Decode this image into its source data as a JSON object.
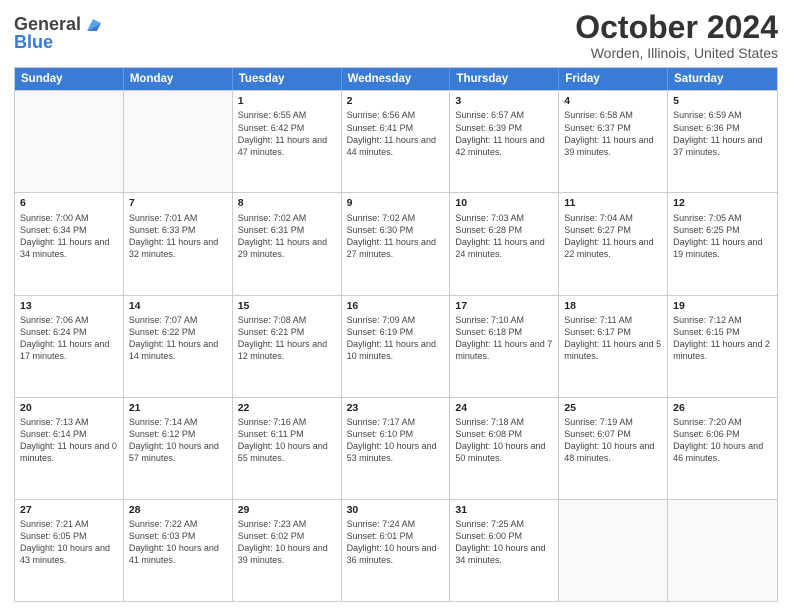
{
  "header": {
    "logo_line1": "General",
    "logo_line2": "Blue",
    "month": "October 2024",
    "location": "Worden, Illinois, United States"
  },
  "days_of_week": [
    "Sunday",
    "Monday",
    "Tuesday",
    "Wednesday",
    "Thursday",
    "Friday",
    "Saturday"
  ],
  "rows": [
    [
      {
        "day": "",
        "empty": true
      },
      {
        "day": "",
        "empty": true
      },
      {
        "day": "1",
        "sunrise": "Sunrise: 6:55 AM",
        "sunset": "Sunset: 6:42 PM",
        "daylight": "Daylight: 11 hours and 47 minutes."
      },
      {
        "day": "2",
        "sunrise": "Sunrise: 6:56 AM",
        "sunset": "Sunset: 6:41 PM",
        "daylight": "Daylight: 11 hours and 44 minutes."
      },
      {
        "day": "3",
        "sunrise": "Sunrise: 6:57 AM",
        "sunset": "Sunset: 6:39 PM",
        "daylight": "Daylight: 11 hours and 42 minutes."
      },
      {
        "day": "4",
        "sunrise": "Sunrise: 6:58 AM",
        "sunset": "Sunset: 6:37 PM",
        "daylight": "Daylight: 11 hours and 39 minutes."
      },
      {
        "day": "5",
        "sunrise": "Sunrise: 6:59 AM",
        "sunset": "Sunset: 6:36 PM",
        "daylight": "Daylight: 11 hours and 37 minutes."
      }
    ],
    [
      {
        "day": "6",
        "sunrise": "Sunrise: 7:00 AM",
        "sunset": "Sunset: 6:34 PM",
        "daylight": "Daylight: 11 hours and 34 minutes."
      },
      {
        "day": "7",
        "sunrise": "Sunrise: 7:01 AM",
        "sunset": "Sunset: 6:33 PM",
        "daylight": "Daylight: 11 hours and 32 minutes."
      },
      {
        "day": "8",
        "sunrise": "Sunrise: 7:02 AM",
        "sunset": "Sunset: 6:31 PM",
        "daylight": "Daylight: 11 hours and 29 minutes."
      },
      {
        "day": "9",
        "sunrise": "Sunrise: 7:02 AM",
        "sunset": "Sunset: 6:30 PM",
        "daylight": "Daylight: 11 hours and 27 minutes."
      },
      {
        "day": "10",
        "sunrise": "Sunrise: 7:03 AM",
        "sunset": "Sunset: 6:28 PM",
        "daylight": "Daylight: 11 hours and 24 minutes."
      },
      {
        "day": "11",
        "sunrise": "Sunrise: 7:04 AM",
        "sunset": "Sunset: 6:27 PM",
        "daylight": "Daylight: 11 hours and 22 minutes."
      },
      {
        "day": "12",
        "sunrise": "Sunrise: 7:05 AM",
        "sunset": "Sunset: 6:25 PM",
        "daylight": "Daylight: 11 hours and 19 minutes."
      }
    ],
    [
      {
        "day": "13",
        "sunrise": "Sunrise: 7:06 AM",
        "sunset": "Sunset: 6:24 PM",
        "daylight": "Daylight: 11 hours and 17 minutes."
      },
      {
        "day": "14",
        "sunrise": "Sunrise: 7:07 AM",
        "sunset": "Sunset: 6:22 PM",
        "daylight": "Daylight: 11 hours and 14 minutes."
      },
      {
        "day": "15",
        "sunrise": "Sunrise: 7:08 AM",
        "sunset": "Sunset: 6:21 PM",
        "daylight": "Daylight: 11 hours and 12 minutes."
      },
      {
        "day": "16",
        "sunrise": "Sunrise: 7:09 AM",
        "sunset": "Sunset: 6:19 PM",
        "daylight": "Daylight: 11 hours and 10 minutes."
      },
      {
        "day": "17",
        "sunrise": "Sunrise: 7:10 AM",
        "sunset": "Sunset: 6:18 PM",
        "daylight": "Daylight: 11 hours and 7 minutes."
      },
      {
        "day": "18",
        "sunrise": "Sunrise: 7:11 AM",
        "sunset": "Sunset: 6:17 PM",
        "daylight": "Daylight: 11 hours and 5 minutes."
      },
      {
        "day": "19",
        "sunrise": "Sunrise: 7:12 AM",
        "sunset": "Sunset: 6:15 PM",
        "daylight": "Daylight: 11 hours and 2 minutes."
      }
    ],
    [
      {
        "day": "20",
        "sunrise": "Sunrise: 7:13 AM",
        "sunset": "Sunset: 6:14 PM",
        "daylight": "Daylight: 11 hours and 0 minutes."
      },
      {
        "day": "21",
        "sunrise": "Sunrise: 7:14 AM",
        "sunset": "Sunset: 6:12 PM",
        "daylight": "Daylight: 10 hours and 57 minutes."
      },
      {
        "day": "22",
        "sunrise": "Sunrise: 7:16 AM",
        "sunset": "Sunset: 6:11 PM",
        "daylight": "Daylight: 10 hours and 55 minutes."
      },
      {
        "day": "23",
        "sunrise": "Sunrise: 7:17 AM",
        "sunset": "Sunset: 6:10 PM",
        "daylight": "Daylight: 10 hours and 53 minutes."
      },
      {
        "day": "24",
        "sunrise": "Sunrise: 7:18 AM",
        "sunset": "Sunset: 6:08 PM",
        "daylight": "Daylight: 10 hours and 50 minutes."
      },
      {
        "day": "25",
        "sunrise": "Sunrise: 7:19 AM",
        "sunset": "Sunset: 6:07 PM",
        "daylight": "Daylight: 10 hours and 48 minutes."
      },
      {
        "day": "26",
        "sunrise": "Sunrise: 7:20 AM",
        "sunset": "Sunset: 6:06 PM",
        "daylight": "Daylight: 10 hours and 46 minutes."
      }
    ],
    [
      {
        "day": "27",
        "sunrise": "Sunrise: 7:21 AM",
        "sunset": "Sunset: 6:05 PM",
        "daylight": "Daylight: 10 hours and 43 minutes."
      },
      {
        "day": "28",
        "sunrise": "Sunrise: 7:22 AM",
        "sunset": "Sunset: 6:03 PM",
        "daylight": "Daylight: 10 hours and 41 minutes."
      },
      {
        "day": "29",
        "sunrise": "Sunrise: 7:23 AM",
        "sunset": "Sunset: 6:02 PM",
        "daylight": "Daylight: 10 hours and 39 minutes."
      },
      {
        "day": "30",
        "sunrise": "Sunrise: 7:24 AM",
        "sunset": "Sunset: 6:01 PM",
        "daylight": "Daylight: 10 hours and 36 minutes."
      },
      {
        "day": "31",
        "sunrise": "Sunrise: 7:25 AM",
        "sunset": "Sunset: 6:00 PM",
        "daylight": "Daylight: 10 hours and 34 minutes."
      },
      {
        "day": "",
        "empty": true
      },
      {
        "day": "",
        "empty": true
      }
    ]
  ]
}
